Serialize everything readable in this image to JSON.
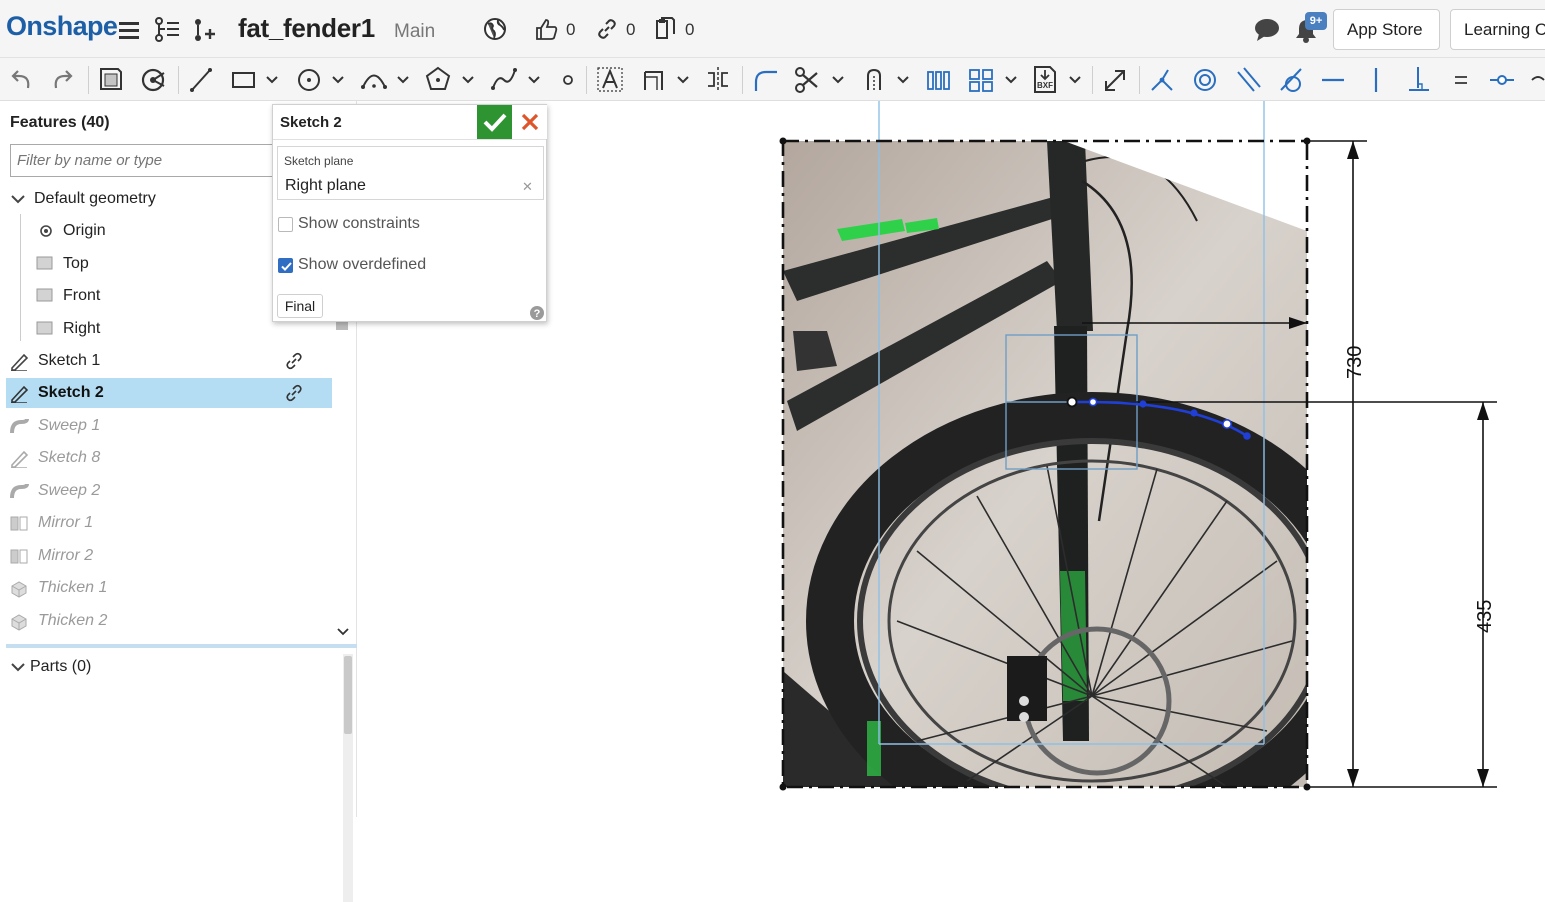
{
  "header": {
    "logo": "Onshape",
    "document_title": "fat_fender1",
    "branch": "Main",
    "likes_count": "0",
    "links_count": "0",
    "copies_count": "0",
    "notification_badge": "9+",
    "app_store_label": "App Store",
    "learning_label": "Learning C"
  },
  "toolbar": {
    "tools": [
      "undo",
      "redo",
      "sketch",
      "extrude",
      "line",
      "rectangle",
      "circle",
      "arc",
      "polygon",
      "spline",
      "point",
      "text",
      "offset",
      "mirror",
      "fillet",
      "trim",
      "extend",
      "pattern",
      "grid",
      "dxf",
      "transform",
      "coincident",
      "concentric",
      "parallel",
      "tangent",
      "horizontal",
      "vertical",
      "perpendicular",
      "equal",
      "midpoint"
    ]
  },
  "features_panel": {
    "title": "Features (40)",
    "filter_placeholder": "Filter by name or type",
    "default_geometry_label": "Default geometry",
    "default_items": [
      {
        "label": "Origin",
        "icon": "origin-icon"
      },
      {
        "label": "Top",
        "icon": "plane-icon"
      },
      {
        "label": "Front",
        "icon": "plane-icon"
      },
      {
        "label": "Right",
        "icon": "plane-icon"
      }
    ],
    "features": [
      {
        "label": "Sketch 1",
        "icon": "sketch-icon",
        "state": "normal",
        "linked": true
      },
      {
        "label": "Sketch 2",
        "icon": "sketch-icon",
        "state": "selected",
        "linked": true
      },
      {
        "label": "Sweep 1",
        "icon": "sweep-icon",
        "state": "suppressed",
        "linked": false
      },
      {
        "label": "Sketch 8",
        "icon": "sketch-icon",
        "state": "suppressed",
        "linked": false
      },
      {
        "label": "Sweep 2",
        "icon": "sweep-icon",
        "state": "suppressed",
        "linked": false
      },
      {
        "label": "Mirror 1",
        "icon": "mirror-icon",
        "state": "suppressed",
        "linked": false
      },
      {
        "label": "Mirror 2",
        "icon": "mirror-icon",
        "state": "suppressed",
        "linked": false
      },
      {
        "label": "Thicken 1",
        "icon": "thicken-icon",
        "state": "suppressed",
        "linked": false
      },
      {
        "label": "Thicken 2",
        "icon": "thicken-icon",
        "state": "suppressed",
        "linked": false
      }
    ],
    "parts_title": "Parts (0)"
  },
  "sketch_dialog": {
    "title": "Sketch 2",
    "plane_label": "Sketch plane",
    "plane_value": "Right plane",
    "show_constraints_label": "Show constraints",
    "show_constraints_checked": false,
    "show_overdefined_label": "Show overdefined",
    "show_overdefined_checked": true,
    "final_label": "Final"
  },
  "viewport": {
    "dimension_height": "730",
    "dimension_axle": "435",
    "curve_color": "#1f3fd6",
    "frame_accent": "#2fd14a"
  },
  "colors": {
    "brand": "#1d5fa6",
    "selection": "#b4dcf3",
    "accept": "#2e9432",
    "cancel": "#e0542a"
  }
}
